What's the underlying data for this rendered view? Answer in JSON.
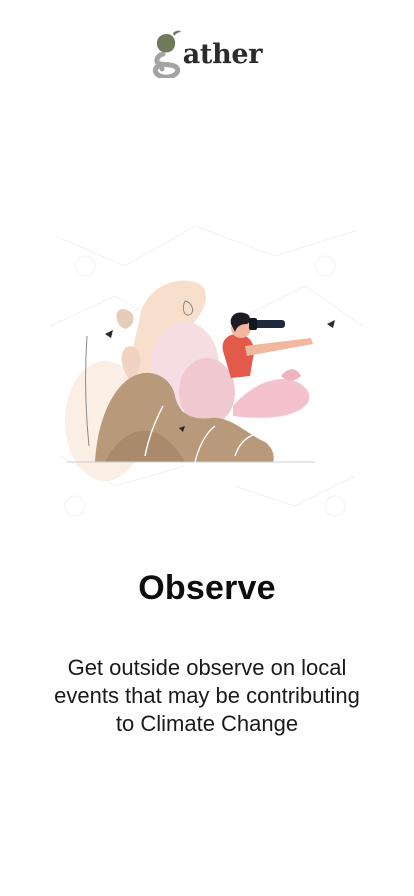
{
  "brand": {
    "logo_text": "gather",
    "logo_suffix": "ather",
    "logo_colors": {
      "green": "#6f7a5b",
      "grey": "#a3a3a3",
      "text": "#2b2b2b"
    }
  },
  "slide": {
    "title": "Observe",
    "description": "Get outside observe on local events that may be contributing to Climate Change",
    "illustration_icon": "person-with-binoculars-illustration"
  }
}
